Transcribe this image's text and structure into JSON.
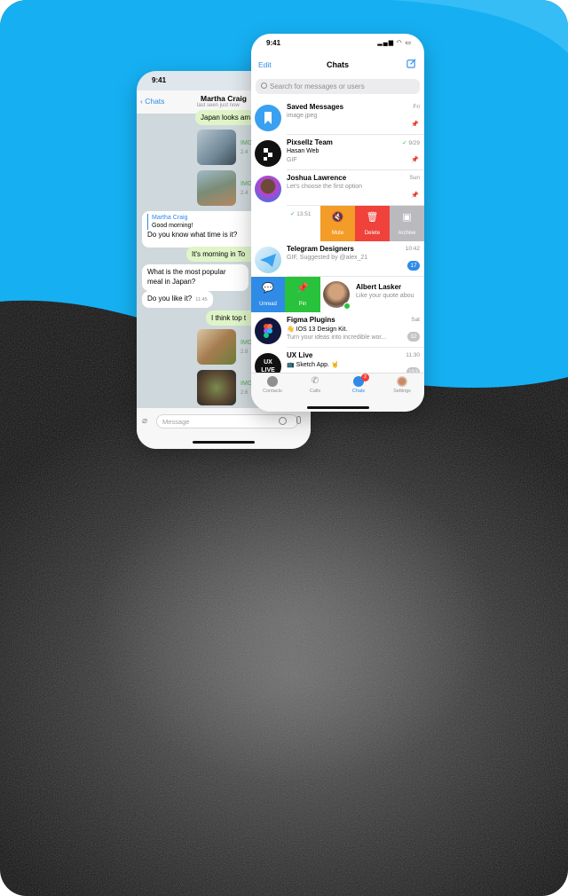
{
  "colors": {
    "accent": "#2f8be6",
    "mute": "#f39c28",
    "delete": "#f0413a",
    "archive": "#b9b9be",
    "unread": "#2f8be6",
    "pin": "#29c23c",
    "sky": "#1cb3f3"
  },
  "back_phone": {
    "status_time": "9:41",
    "back_label": "Chats",
    "contact_name": "Martha Craig",
    "contact_status": "last seen just now",
    "messages": [
      {
        "text": "Japan looks am"
      },
      {
        "img_label": "IMG",
        "img_sub": "2.4"
      },
      {
        "img_label": "IMG",
        "img_sub": "2.4"
      },
      {
        "reply_name": "Martha Craig",
        "reply_text": "Good morning!",
        "text": "Do you know what time is it?"
      },
      {
        "text": "It's morning in To"
      },
      {
        "text": "What is the most popular",
        "text2": "meal in Japan?"
      },
      {
        "text": "Do you like it?",
        "time": "11:45"
      },
      {
        "text": "I think top t"
      },
      {
        "img_label": "IMG",
        "img_sub": "2.8"
      },
      {
        "img_label": "IMG",
        "img_sub": "2.6"
      }
    ],
    "input_placeholder": "Message"
  },
  "front_phone": {
    "status_time": "9:41",
    "edit_label": "Edit",
    "title": "Chats",
    "search_placeholder": "Search for messages or users",
    "chats": [
      {
        "name": "Saved Messages",
        "line1": "image.jpeg",
        "time": "Fri",
        "pinned": true
      },
      {
        "name": "Pixsellz Team",
        "line1": "Hasan Web",
        "line2": "GIF",
        "time": "9/29",
        "pinned": true
      },
      {
        "name": "Joshua Lawrence",
        "line1": "Let's choose the first option",
        "time": "Sun",
        "pinned": true
      },
      {
        "time": "13:51"
      },
      {
        "name": "Telegram Designers",
        "line1": "GIF, Suggested by @alex_21",
        "time": "10:42",
        "badge": "17"
      },
      {
        "name": "Albert Lasker",
        "line1": "Like your quote abou"
      },
      {
        "name": "Figma Plugins",
        "line1": "👋 IOS 13 Design Kit.",
        "line2": "Turn your ideas into incredible wor...",
        "time": "Sat",
        "badge": "32"
      },
      {
        "name": "UX Live",
        "line1": "📺 Sketch App. 🤘",
        "time": "11:30",
        "badge": "153"
      }
    ],
    "swipe_actions": [
      "Mute",
      "Delete",
      "Archive"
    ],
    "left_actions": [
      "Unread",
      "Pin"
    ],
    "tabs": [
      "Contacts",
      "Calls",
      "Chats",
      "Settings"
    ],
    "chats_badge": "2"
  }
}
